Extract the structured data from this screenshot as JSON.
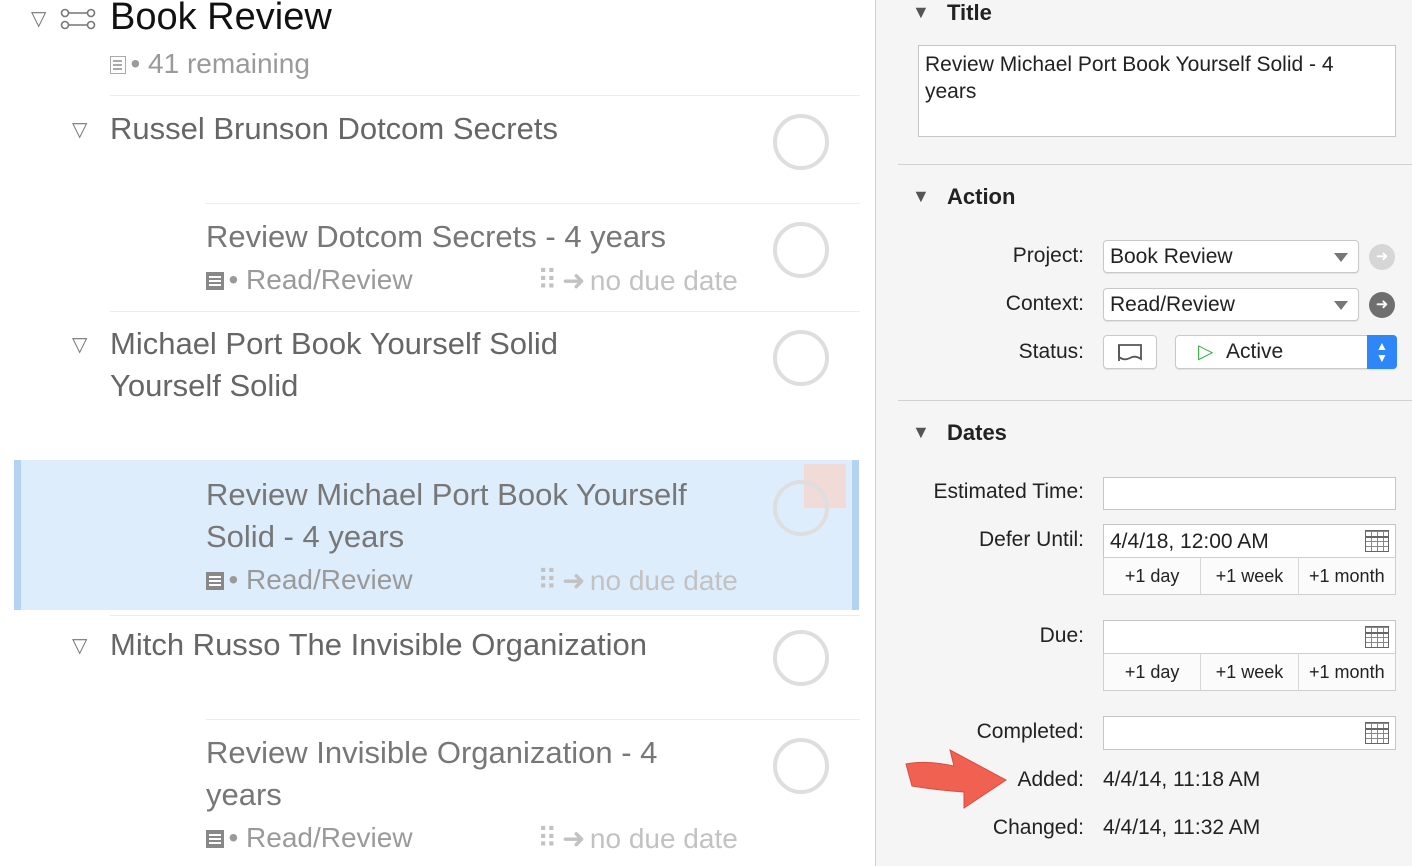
{
  "outline": {
    "project": {
      "title": "Book Review",
      "remaining": "• 41 remaining"
    },
    "groups": [
      {
        "title": "Russel Brunson Dotcom Secrets",
        "action": {
          "title": "Review Dotcom Secrets - 4 years",
          "context": "• Read/Review",
          "due": "no due date"
        }
      },
      {
        "title_line1": "Michael Port Book Yourself Solid",
        "title_line2": "Yourself Solid",
        "action": {
          "title_line1": "Review Michael Port Book Yourself",
          "title_line2": "Solid - 4 years",
          "context": "• Read/Review",
          "due": "no due date"
        }
      },
      {
        "title": "Mitch Russo The Invisible Organization",
        "action": {
          "title_line1": "Review Invisible Organization - 4",
          "title_line2": "years",
          "context": "• Read/Review",
          "due": "no due date"
        }
      }
    ]
  },
  "inspector": {
    "title_section": {
      "header": "Title",
      "value": "Review Michael Port Book Yourself Solid - 4 years"
    },
    "action_section": {
      "header": "Action",
      "project_label": "Project:",
      "project_value": "Book Review",
      "context_label": "Context:",
      "context_value": "Read/Review",
      "status_label": "Status:",
      "status_value": "Active"
    },
    "dates_section": {
      "header": "Dates",
      "estimated_label": "Estimated Time:",
      "estimated_value": "",
      "defer_label": "Defer Until:",
      "defer_value": "4/4/18, 12:00 AM",
      "due_label": "Due:",
      "due_value": "",
      "completed_label": "Completed:",
      "completed_value": "",
      "added_label": "Added:",
      "added_value": "4/4/14, 11:18 AM",
      "changed_label": "Changed:",
      "changed_value": "4/4/14, 11:32 AM",
      "quick_buttons": [
        "+1 day",
        "+1 week",
        "+1 month"
      ]
    }
  },
  "colors": {
    "selection": "#deedfc",
    "accent_blue": "#2f86f6",
    "active_green": "#3cb043",
    "arrow_red": "#f05a4a"
  }
}
